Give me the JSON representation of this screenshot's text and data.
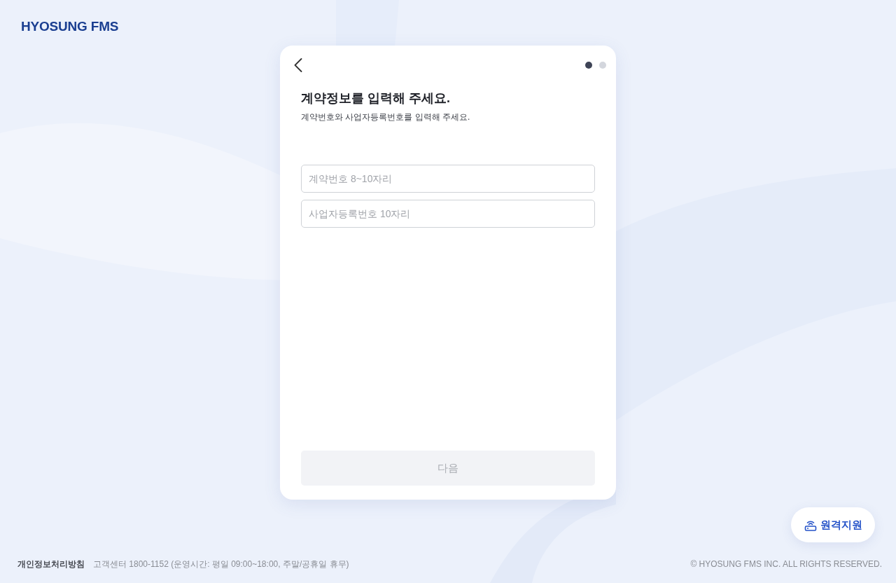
{
  "logo": {
    "text": "HYOSUNG FMS"
  },
  "card": {
    "steps": [
      {
        "selected": true
      },
      {
        "selected": false
      }
    ],
    "title": "계약정보를 입력해 주세요.",
    "subtitle": "계약번호와 사업자등록번호를 입력해 주세요.",
    "fields": [
      {
        "placeholder": "계약번호 8~10자리"
      },
      {
        "placeholder": "사업자등록번호 10자리"
      }
    ],
    "next_button": {
      "label": "다음",
      "disabled": true
    }
  },
  "remote_support_button": {
    "label": "원격지원"
  },
  "footer": {
    "privacy_link": "개인정보처리방침",
    "customer_center": "고객센터 1800-1152 (운영시간: 평일 09:00~18:00, 주말/공휴일 휴무)",
    "copyright": "© HYOSUNG FMS INC. ALL RIGHTS RESERVED."
  }
}
